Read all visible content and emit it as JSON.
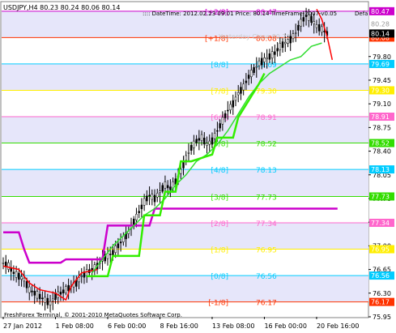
{
  "header": {
    "symbol_quote": "USDJPY,H4  80.23 80.24 80.06 80.14",
    "info": ":::: DateTime: 2012.02.23 09:01   Price: 80.14   TimeFrame-2007-v0.05",
    "corner": "Defa",
    "watermark": "Yesterday Close 80.22"
  },
  "footer": {
    "copyright": "FreshForex Terminal, © 2001-2010 MetaQuotes Software Corp."
  },
  "murrey_levels": [
    {
      "label": "[+2/8]",
      "value": 80.47,
      "value_text": "80.47",
      "color": "#cc00cc",
      "fill": "#cc00cc",
      "text_color": "#ffffff"
    },
    {
      "label": "[+1/8]",
      "value": 80.08,
      "value_text": "80.08",
      "color": "#ff3300",
      "fill": "#ff3300",
      "text_color": "#ffffff"
    },
    {
      "label": "[8/8]",
      "value": 79.69,
      "value_text": "79.69",
      "color": "#00ccff",
      "fill": "#00ccff",
      "text_color": "#ffffff"
    },
    {
      "label": "[7/8]",
      "value": 79.3,
      "value_text": "79.30",
      "color": "#ffee00",
      "fill": "#ffee00",
      "text_color": "#ffffff"
    },
    {
      "label": "[6/8]",
      "value": 78.91,
      "value_text": "78.91",
      "color": "#ff66cc",
      "fill": "#ff66cc",
      "text_color": "#ffffff"
    },
    {
      "label": "[5/8]",
      "value": 78.52,
      "value_text": "78.52",
      "color": "#33dd00",
      "fill": "#33dd00",
      "text_color": "#ffffff"
    },
    {
      "label": "[4/8]",
      "value": 78.13,
      "value_text": "78.13",
      "color": "#00ccff",
      "fill": "#00ccff",
      "text_color": "#ffffff"
    },
    {
      "label": "[3/8]",
      "value": 77.73,
      "value_text": "77.73",
      "color": "#33dd00",
      "fill": "#33dd00",
      "text_color": "#ffffff"
    },
    {
      "label": "[2/8]",
      "value": 77.34,
      "value_text": "77.34",
      "color": "#ff66cc",
      "fill": "#ff66cc",
      "text_color": "#ffffff"
    },
    {
      "label": "[1/8]",
      "value": 76.95,
      "value_text": "76.95",
      "color": "#ffee00",
      "fill": "#ffee00",
      "text_color": "#ffffff"
    },
    {
      "label": "[0/8]",
      "value": 76.56,
      "value_text": "76.56",
      "color": "#00ccff",
      "fill": "#00ccff",
      "text_color": "#ffffff"
    },
    {
      "label": "[-1/8]",
      "value": 76.17,
      "value_text": "76.17",
      "color": "#ff3300",
      "fill": "#ff3300",
      "text_color": "#ffffff"
    }
  ],
  "chart_data": {
    "type": "line",
    "title": "USDJPY,H4",
    "timeframe": "H4",
    "last_price": 80.14,
    "ylim": [
      75.95,
      80.6
    ],
    "y_ticks": [
      79.8,
      79.45,
      79.1,
      78.75,
      78.4,
      78.05,
      77.7,
      77.35,
      77.0,
      76.65,
      76.3,
      75.95
    ],
    "y_tick_labels": [
      "79.80",
      "79.45",
      "79.10",
      "78.75",
      "78.40",
      "78.05",
      "77.70",
      "77.35",
      "77.00",
      "76.65",
      "76.30",
      "75.95"
    ],
    "y_label_overlays": [
      {
        "text": "80.28",
        "value": 80.28,
        "fill": "#ffffff",
        "text_color": "#999999"
      },
      {
        "text": "80.14",
        "value": 80.14,
        "fill": "#000000",
        "text_color": "#ffffff"
      }
    ],
    "x_tick_labels": [
      "27 Jan 2012",
      "1 Feb 08:00",
      "6 Feb 00:00",
      "8 Feb 16:00",
      "13 Feb 08:00",
      "16 Feb 00:00",
      "20 Feb 16:00"
    ],
    "x_tick_positions": [
      0,
      20,
      40,
      60,
      80,
      100,
      120
    ],
    "bars_count": 138,
    "price_path": [
      [
        0,
        76.75
      ],
      [
        2,
        76.7
      ],
      [
        4,
        76.6
      ],
      [
        6,
        76.55
      ],
      [
        8,
        76.5
      ],
      [
        10,
        76.35
      ],
      [
        12,
        76.3
      ],
      [
        14,
        76.25
      ],
      [
        16,
        76.2
      ],
      [
        18,
        76.15
      ],
      [
        20,
        76.25
      ],
      [
        22,
        76.3
      ],
      [
        24,
        76.35
      ],
      [
        26,
        76.4
      ],
      [
        28,
        76.45
      ],
      [
        30,
        76.55
      ],
      [
        32,
        76.6
      ],
      [
        34,
        76.65
      ],
      [
        36,
        76.7
      ],
      [
        38,
        76.8
      ],
      [
        40,
        76.85
      ],
      [
        42,
        76.9
      ],
      [
        44,
        77.0
      ],
      [
        46,
        77.1
      ],
      [
        48,
        77.2
      ],
      [
        50,
        77.35
      ],
      [
        52,
        77.5
      ],
      [
        54,
        77.65
      ],
      [
        56,
        77.75
      ],
      [
        58,
        77.7
      ],
      [
        60,
        77.8
      ],
      [
        62,
        77.9
      ],
      [
        64,
        77.85
      ],
      [
        66,
        77.95
      ],
      [
        68,
        78.1
      ],
      [
        70,
        78.3
      ],
      [
        72,
        78.45
      ],
      [
        74,
        78.55
      ],
      [
        76,
        78.6
      ],
      [
        78,
        78.5
      ],
      [
        80,
        78.55
      ],
      [
        82,
        78.7
      ],
      [
        84,
        78.85
      ],
      [
        86,
        79.0
      ],
      [
        88,
        79.1
      ],
      [
        90,
        79.25
      ],
      [
        92,
        79.35
      ],
      [
        94,
        79.5
      ],
      [
        96,
        79.6
      ],
      [
        98,
        79.7
      ],
      [
        100,
        79.75
      ],
      [
        102,
        79.8
      ],
      [
        104,
        79.85
      ],
      [
        106,
        79.95
      ],
      [
        108,
        80.0
      ],
      [
        110,
        80.05
      ],
      [
        112,
        80.15
      ],
      [
        114,
        80.3
      ],
      [
        116,
        80.4
      ],
      [
        118,
        80.35
      ],
      [
        120,
        80.25
      ],
      [
        122,
        80.2
      ],
      [
        124,
        80.14
      ]
    ],
    "series": [
      {
        "name": "",
        "color": "#cc00cc",
        "values": [
          [
            0,
            77.2
          ],
          [
            6,
            77.2
          ],
          [
            8,
            76.95
          ],
          [
            10,
            76.75
          ],
          [
            22,
            76.75
          ],
          [
            24,
            76.8
          ],
          [
            38,
            76.8
          ],
          [
            40,
            77.3
          ],
          [
            56,
            77.3
          ],
          [
            58,
            77.55
          ],
          [
            128,
            77.55
          ]
        ]
      },
      {
        "name": "",
        "color": "#ff0000",
        "values": [
          [
            0,
            76.7
          ],
          [
            6,
            76.65
          ],
          [
            10,
            76.45
          ],
          [
            14,
            76.35
          ],
          [
            20,
            76.3
          ],
          [
            24,
            76.2
          ],
          [
            26,
            76.4
          ],
          [
            30,
            76.6
          ],
          [
            36,
            76.65
          ]
        ]
      },
      {
        "name": "",
        "color": "#33dd33",
        "values": [
          [
            34,
            76.6
          ],
          [
            38,
            76.8
          ],
          [
            42,
            77.0
          ],
          [
            46,
            77.15
          ],
          [
            50,
            77.3
          ],
          [
            54,
            77.45
          ],
          [
            58,
            77.55
          ],
          [
            62,
            77.7
          ],
          [
            66,
            77.9
          ],
          [
            70,
            78.05
          ],
          [
            74,
            78.25
          ],
          [
            78,
            78.35
          ],
          [
            82,
            78.5
          ],
          [
            86,
            78.7
          ],
          [
            90,
            78.95
          ],
          [
            94,
            79.2
          ],
          [
            98,
            79.4
          ],
          [
            102,
            79.55
          ],
          [
            106,
            79.65
          ],
          [
            110,
            79.75
          ],
          [
            114,
            79.8
          ],
          [
            118,
            79.95
          ],
          [
            122,
            80.0
          ]
        ]
      },
      {
        "name": "",
        "color": "#33ee00",
        "values": [
          [
            32,
            76.55
          ],
          [
            40,
            76.55
          ],
          [
            42,
            76.85
          ],
          [
            52,
            76.85
          ],
          [
            54,
            77.45
          ],
          [
            60,
            77.45
          ],
          [
            62,
            77.8
          ],
          [
            66,
            77.8
          ],
          [
            68,
            78.25
          ],
          [
            72,
            78.25
          ],
          [
            76,
            78.3
          ],
          [
            80,
            78.35
          ],
          [
            82,
            78.6
          ],
          [
            88,
            78.6
          ],
          [
            90,
            78.9
          ],
          [
            94,
            79.15
          ],
          [
            98,
            79.4
          ],
          [
            100,
            79.55
          ]
        ]
      },
      {
        "name": "",
        "color": "#ff0000",
        "values": [
          [
            120,
            80.5
          ],
          [
            122,
            80.35
          ],
          [
            124,
            80.1
          ],
          [
            126,
            79.75
          ]
        ]
      }
    ]
  }
}
